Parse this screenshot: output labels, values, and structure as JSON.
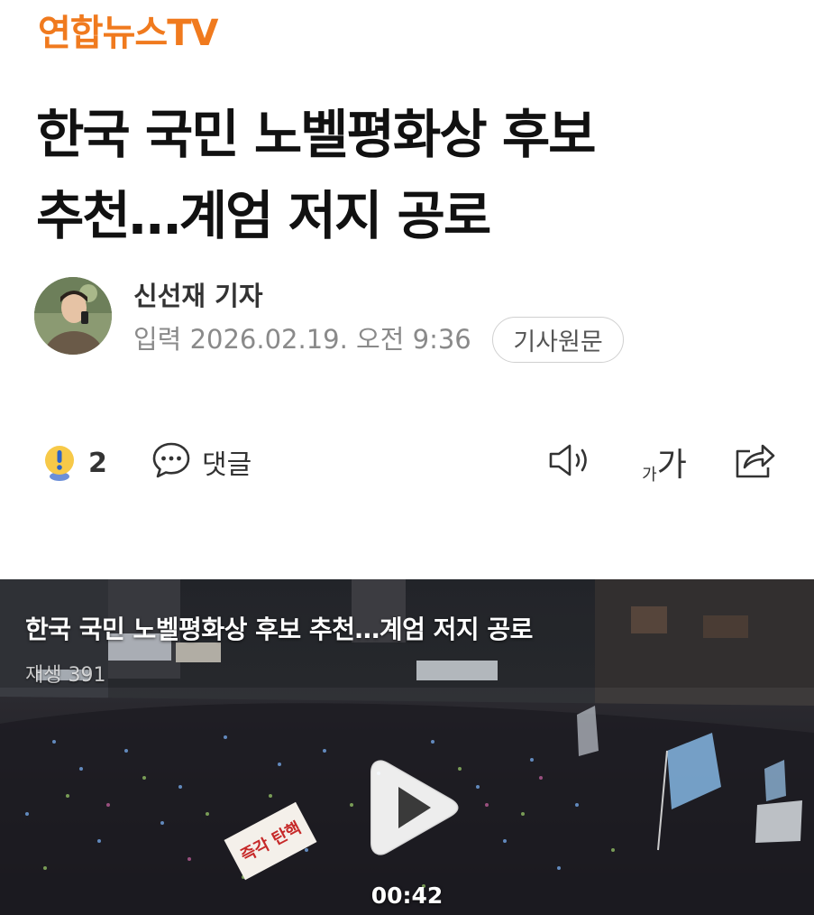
{
  "brand": {
    "logo_text": "연합뉴스TV",
    "color": "#f07a1e"
  },
  "article": {
    "headline_line1": "한국 국민 노벨평화상 후보",
    "headline_line2": "추천…계엄 저지 공로",
    "author": "신선재 기자",
    "published": "입력 2026.02.19. 오전 9:36",
    "source_button": "기사원문"
  },
  "actions": {
    "reaction_count": "2",
    "comment_label": "댓글",
    "font_small": "가",
    "font_big": "가",
    "icons": [
      "exclamation-reaction-icon",
      "comment-bubble-icon",
      "speaker-icon",
      "font-size-icon",
      "share-icon"
    ]
  },
  "video": {
    "title": "한국 국민 노벨평화상 후보 추천…계엄 저지 공로",
    "play_count": "재생 391",
    "duration": "00:42",
    "sign_text": "즉각 탄핵"
  }
}
